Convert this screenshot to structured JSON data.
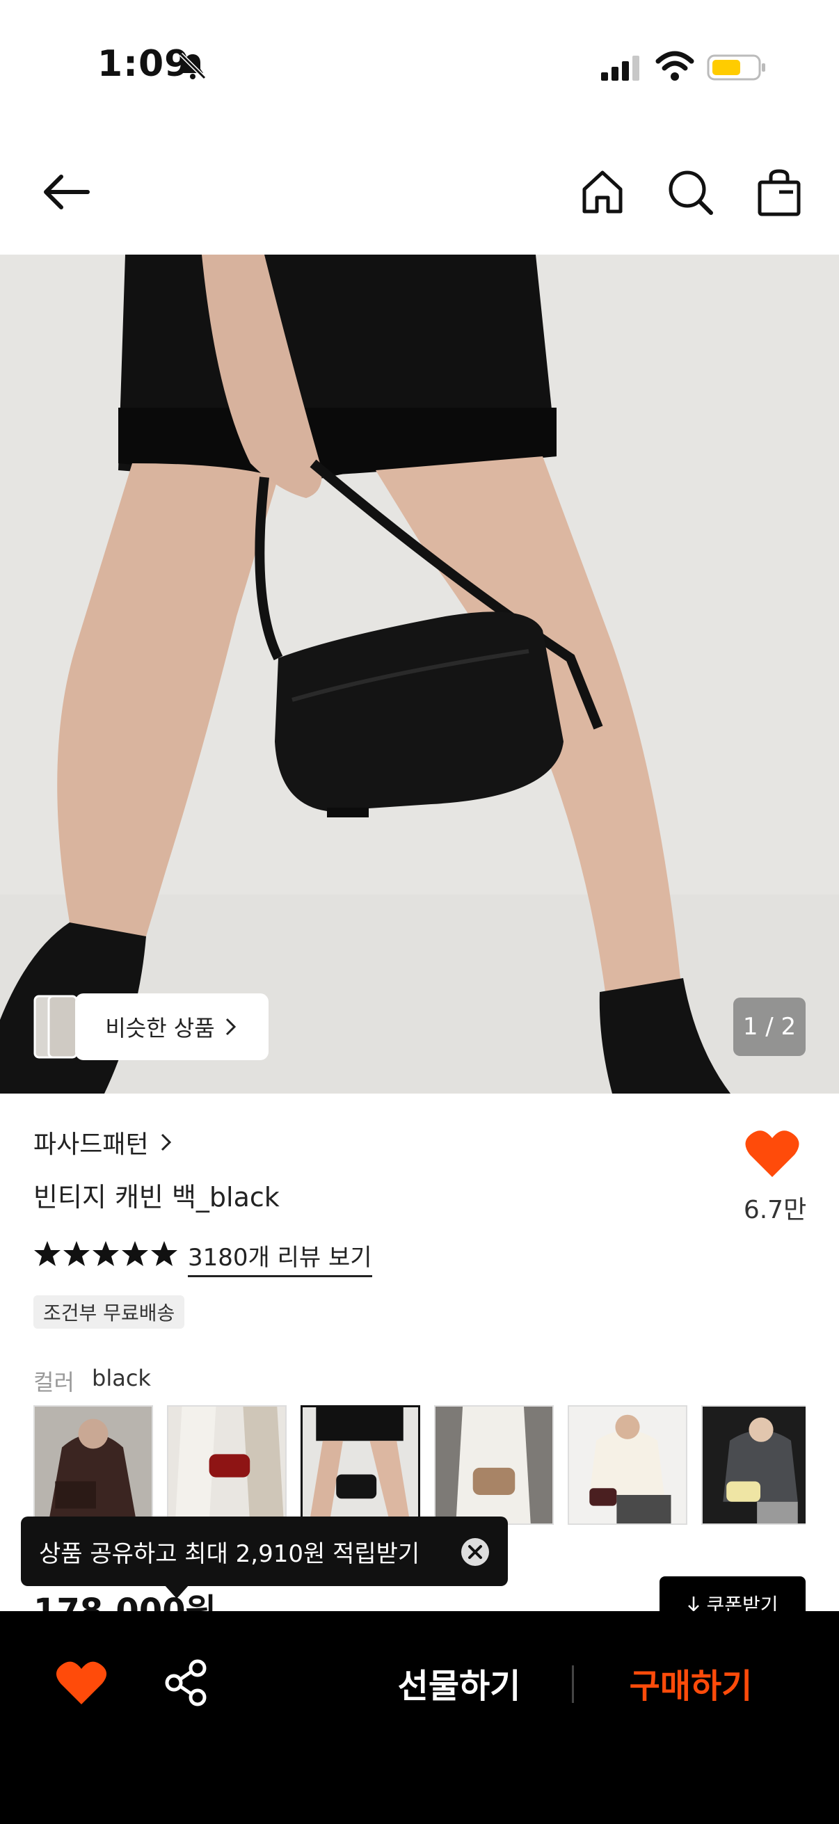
{
  "status_bar": {
    "time": "1:09",
    "icons": [
      "bell-slash-icon",
      "cellular-signal-icon",
      "wifi-icon",
      "battery-icon"
    ]
  },
  "nav": {
    "icons": [
      "back-arrow-icon",
      "home-icon",
      "search-icon",
      "shopping-bag-icon"
    ]
  },
  "hero": {
    "similar_label": "비슷한 상품",
    "page_counter": "1 / 2"
  },
  "product": {
    "brand": "파사드패턴",
    "title": "빈티지 캐빈 백_black",
    "likes": "6.7만",
    "rating_stars": 5,
    "review_link": "3180개 리뷰 보기",
    "shipping_badge": "조건부 무료배송",
    "color_label": "컬러",
    "color_value": "black",
    "color_options": [
      {
        "name": "brown",
        "selected": false
      },
      {
        "name": "red",
        "selected": false
      },
      {
        "name": "black",
        "selected": true
      },
      {
        "name": "beige",
        "selected": false
      },
      {
        "name": "burgundy",
        "selected": false
      },
      {
        "name": "butter",
        "selected": false
      }
    ],
    "price": "178,000원",
    "coupon_label": "쿠폰받기"
  },
  "tooltip": {
    "text": "상품 공유하고 최대 2,910원 적립받기"
  },
  "bottom_bar": {
    "gift_label": "선물하기",
    "buy_label": "구매하기"
  },
  "colors": {
    "accent_orange": "#ff4b0a",
    "bar_black": "#000000"
  }
}
